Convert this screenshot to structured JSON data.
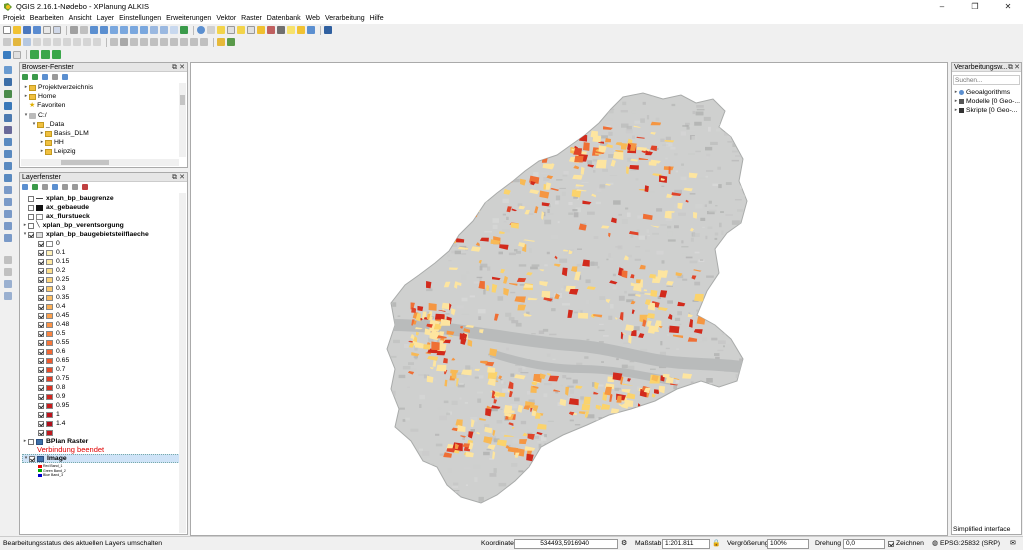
{
  "window": {
    "title": "QGIS 2.16.1-Nødebo - XPlanung ALKIS"
  },
  "menu": [
    "Projekt",
    "Bearbeiten",
    "Ansicht",
    "Layer",
    "Einstellungen",
    "Erweiterungen",
    "Vektor",
    "Raster",
    "Datenbank",
    "Web",
    "Verarbeitung",
    "Hilfe"
  ],
  "browser": {
    "title": "Browser-Fenster",
    "items": [
      {
        "label": "Projektverzeichnis"
      },
      {
        "label": "Home"
      },
      {
        "label": "Favoriten"
      },
      {
        "label": "C:/"
      },
      {
        "label": "_Data"
      },
      {
        "label": "Basis_DLM"
      },
      {
        "label": "HH"
      },
      {
        "label": "Leipzig"
      }
    ]
  },
  "layers": {
    "title": "Layerfenster",
    "top": [
      {
        "label": "xplan_bp_baugrenze"
      },
      {
        "label": "ax_gebaeude"
      },
      {
        "label": "ax_flurstueck"
      },
      {
        "label": "xplan_bp_verentsorgung"
      },
      {
        "label": "xplan_bp_baugebietsteilflaeche"
      }
    ],
    "classes": [
      {
        "label": "0",
        "color": "#ffffff"
      },
      {
        "label": "0.1",
        "color": "#fff1b8"
      },
      {
        "label": "0.15",
        "color": "#ffe9a2"
      },
      {
        "label": "0.2",
        "color": "#fde08c"
      },
      {
        "label": "0.25",
        "color": "#fdd57b"
      },
      {
        "label": "0.3",
        "color": "#fdca6c"
      },
      {
        "label": "0.35",
        "color": "#fdbd60"
      },
      {
        "label": "0.4",
        "color": "#fcaf55"
      },
      {
        "label": "0.45",
        "color": "#fca14d"
      },
      {
        "label": "0.48",
        "color": "#fb9346"
      },
      {
        "label": "0.5",
        "color": "#fa8440"
      },
      {
        "label": "0.55",
        "color": "#f7763a"
      },
      {
        "label": "0.6",
        "color": "#f36834"
      },
      {
        "label": "0.65",
        "color": "#ee5a2f"
      },
      {
        "label": "0.7",
        "color": "#e84c2a"
      },
      {
        "label": "0.75",
        "color": "#e23f26"
      },
      {
        "label": "0.8",
        "color": "#da3222"
      },
      {
        "label": "0.9",
        "color": "#d2261f"
      },
      {
        "label": "0.95",
        "color": "#c81b1c"
      },
      {
        "label": "1",
        "color": "#bd121b"
      },
      {
        "label": "1.4",
        "color": "#b00d1a"
      },
      {
        "label": "",
        "color": "#c0181e"
      }
    ],
    "raster": {
      "label": "BPlan Raster",
      "note": "Verbindung beendet"
    },
    "image": {
      "label": "Image",
      "bands": [
        "Red",
        "Band_1",
        "Green",
        "Band_2",
        "Blue",
        "Band_3"
      ]
    }
  },
  "processing": {
    "title": "Verarbeitungsw...",
    "search_placeholder": "Suchen...",
    "items": [
      {
        "label": "Geoalgorithms"
      },
      {
        "label": "Modelle [0 Geo-..."
      },
      {
        "label": "Skripte [0 Geo-..."
      }
    ],
    "mode": "Simplified interface"
  },
  "status": {
    "message": "Bearbeitungsstatus des aktuellen Layers umschalten",
    "coord_label": "Koordinate",
    "coord_value": "534493,5916940",
    "scale_label": "Maßstab",
    "scale_value": "1:201.811",
    "magnifier_label": "Vergrößerung",
    "magnifier_value": "100%",
    "rotation_label": "Drehung",
    "rotation_value": "0,0",
    "render_label": "Zeichnen",
    "crs": "EPSG:25832 (SRP)"
  },
  "colors": {
    "accent": "#2f6fbf",
    "patch_light": "#fbd36c",
    "patch_mid": "#f28a3c",
    "patch_dark": "#d22a1c",
    "land": "#cfd0cf",
    "water": "#b9bbbb"
  }
}
